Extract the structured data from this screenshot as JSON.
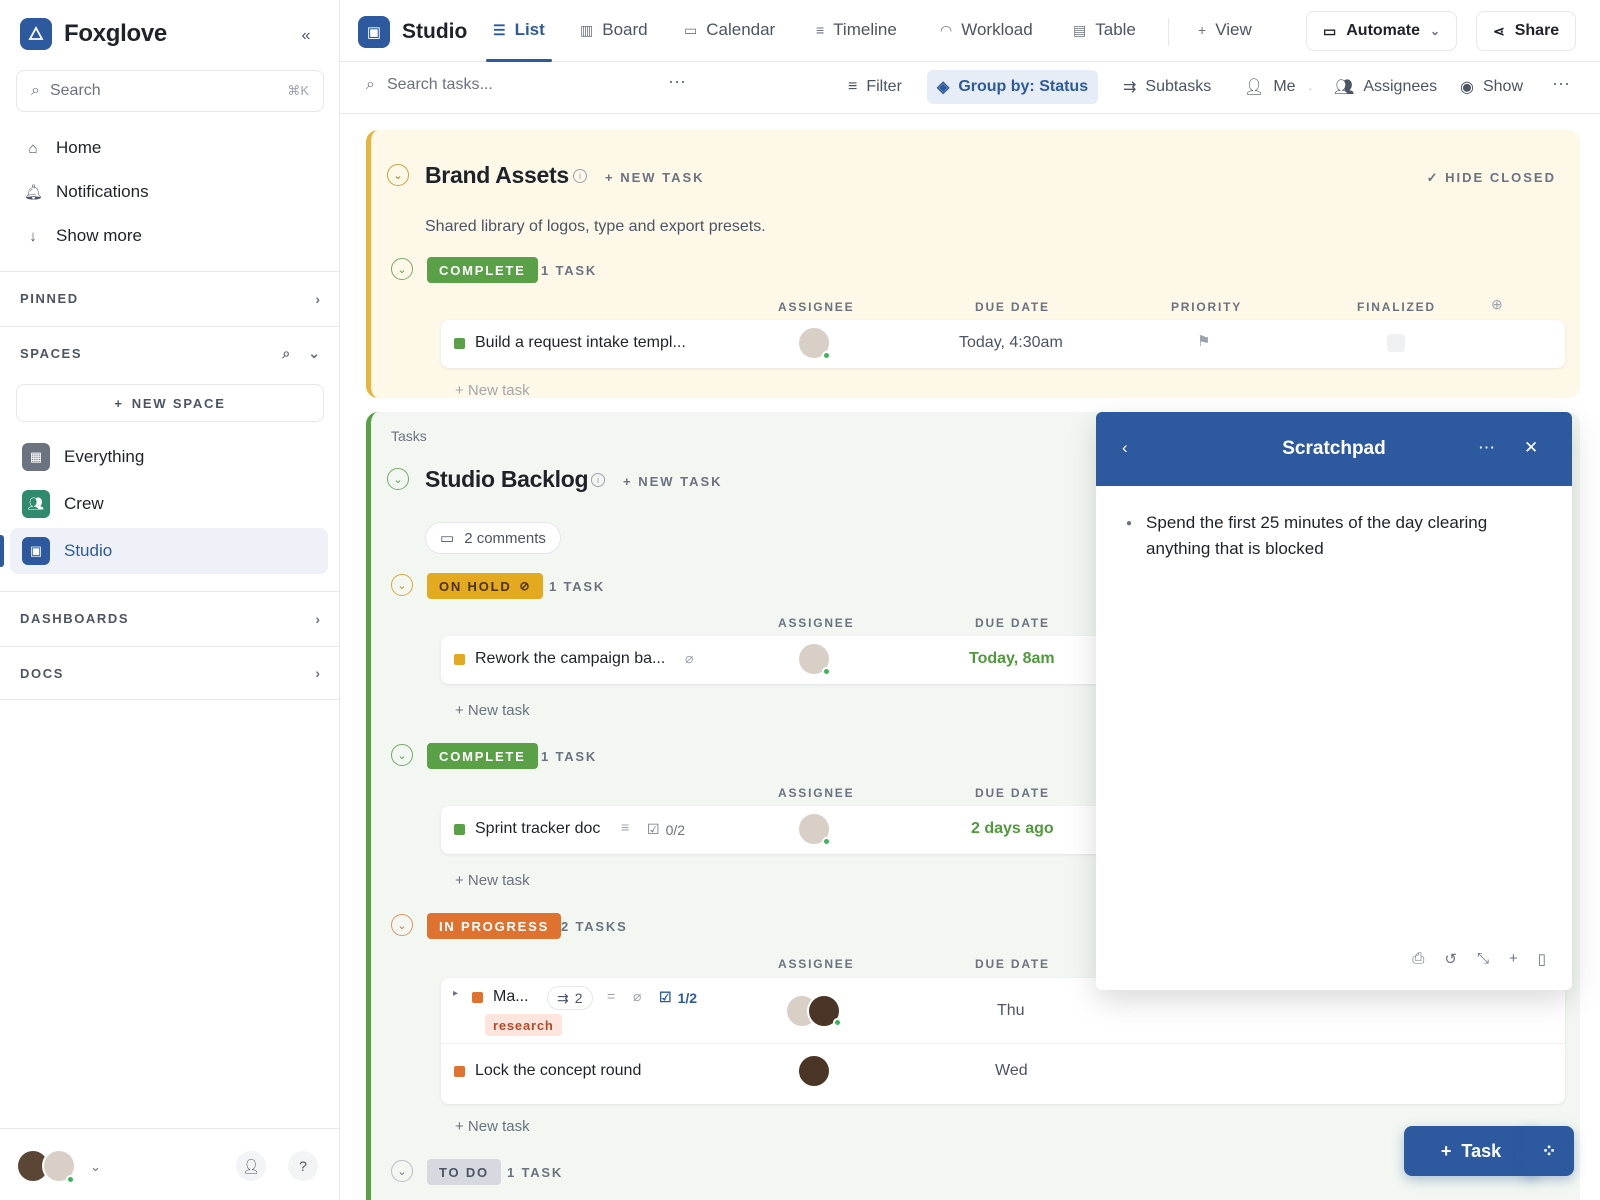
{
  "brand": {
    "name": "Foxglove",
    "logo_icon": "triangle-logo-icon",
    "collapse_icon": "double-chevron-left-icon"
  },
  "sidebar": {
    "search_placeholder": "Search",
    "search_shortcut": "⌘K",
    "nav": [
      {
        "label": "Home",
        "icon": "home-icon"
      },
      {
        "label": "Notifications",
        "icon": "bell-icon"
      },
      {
        "label": "Show more",
        "icon": "arrow-down-icon"
      }
    ],
    "pinned_label": "PINNED",
    "spaces_label": "SPACES",
    "new_space_label": "NEW SPACE",
    "spaces": [
      {
        "label": "Everything",
        "color": "#6b7280",
        "active": false
      },
      {
        "label": "Crew",
        "color": "#2f8a6e",
        "active": false
      },
      {
        "label": "Studio",
        "color": "#2d5a9e",
        "active": true
      }
    ],
    "dashboards_label": "DASHBOARDS",
    "docs_label": "DOCS"
  },
  "topbar": {
    "workspace": "Studio",
    "tabs": [
      {
        "label": "List",
        "icon": "list-icon",
        "active": true
      },
      {
        "label": "Board",
        "icon": "board-icon"
      },
      {
        "label": "Calendar",
        "icon": "calendar-icon"
      },
      {
        "label": "Timeline",
        "icon": "timeline-icon"
      },
      {
        "label": "Workload",
        "icon": "workload-icon"
      },
      {
        "label": "Table",
        "icon": "table-icon"
      }
    ],
    "add_view_label": "View",
    "automate_label": "Automate",
    "share_label": "Share"
  },
  "toolbar": {
    "search_placeholder": "Search tasks...",
    "filter": "Filter",
    "group_by": "Group by: Status",
    "subtasks": "Subtasks",
    "me": "Me",
    "assignees": "Assignees",
    "show": "Show"
  },
  "groups": {
    "brand_assets": {
      "title": "Brand Assets",
      "new_task": "+ NEW TASK",
      "hide_closed": "✓ HIDE CLOSED",
      "description": "Shared library of logos, type and export presets.",
      "status": "COMPLETE",
      "count": "1 TASK",
      "columns": [
        "ASSIGNEE",
        "DUE DATE",
        "PRIORITY",
        "FINALIZED"
      ],
      "task": {
        "name": "Build a request intake templ...",
        "due": "Today, 4:30am"
      },
      "new_task_row": "+ New task"
    },
    "backlog": {
      "breadcrumb": "Tasks",
      "title": "Studio Backlog",
      "new_task": "+ NEW TASK",
      "comments": "2 comments",
      "on_hold": {
        "status": "ON HOLD",
        "count": "1 TASK",
        "task": "Rework the campaign ba...",
        "due": "Today, 8am"
      },
      "complete": {
        "status": "COMPLETE",
        "count": "1 TASK",
        "task": "Sprint tracker doc",
        "checklist": "0/2",
        "due": "2 days ago"
      },
      "in_progress": {
        "status": "IN PROGRESS",
        "count": "2 TASKS",
        "task1": {
          "name": "Ma...",
          "subtasks": "2",
          "checklist": "1/2",
          "tag": "research",
          "due": "Thu"
        },
        "task2": {
          "name": "Lock the concept round",
          "due": "Wed"
        }
      },
      "todo": {
        "status": "TO DO",
        "count": "1 TASK"
      },
      "col_assignee": "ASSIGNEE",
      "col_due": "DUE DATE",
      "new_task_row": "+ New task"
    }
  },
  "scratchpad": {
    "title": "Scratchpad",
    "note": "Spend the first 25 minutes of the day clearing anything that is blocked"
  },
  "fab": {
    "task_label": "Task"
  },
  "colors": {
    "accent": "#2d5a9e",
    "complete": "#5aa046",
    "on_hold": "#e3a91f",
    "in_progress": "#e0722f",
    "todo": "#d6dae0"
  }
}
